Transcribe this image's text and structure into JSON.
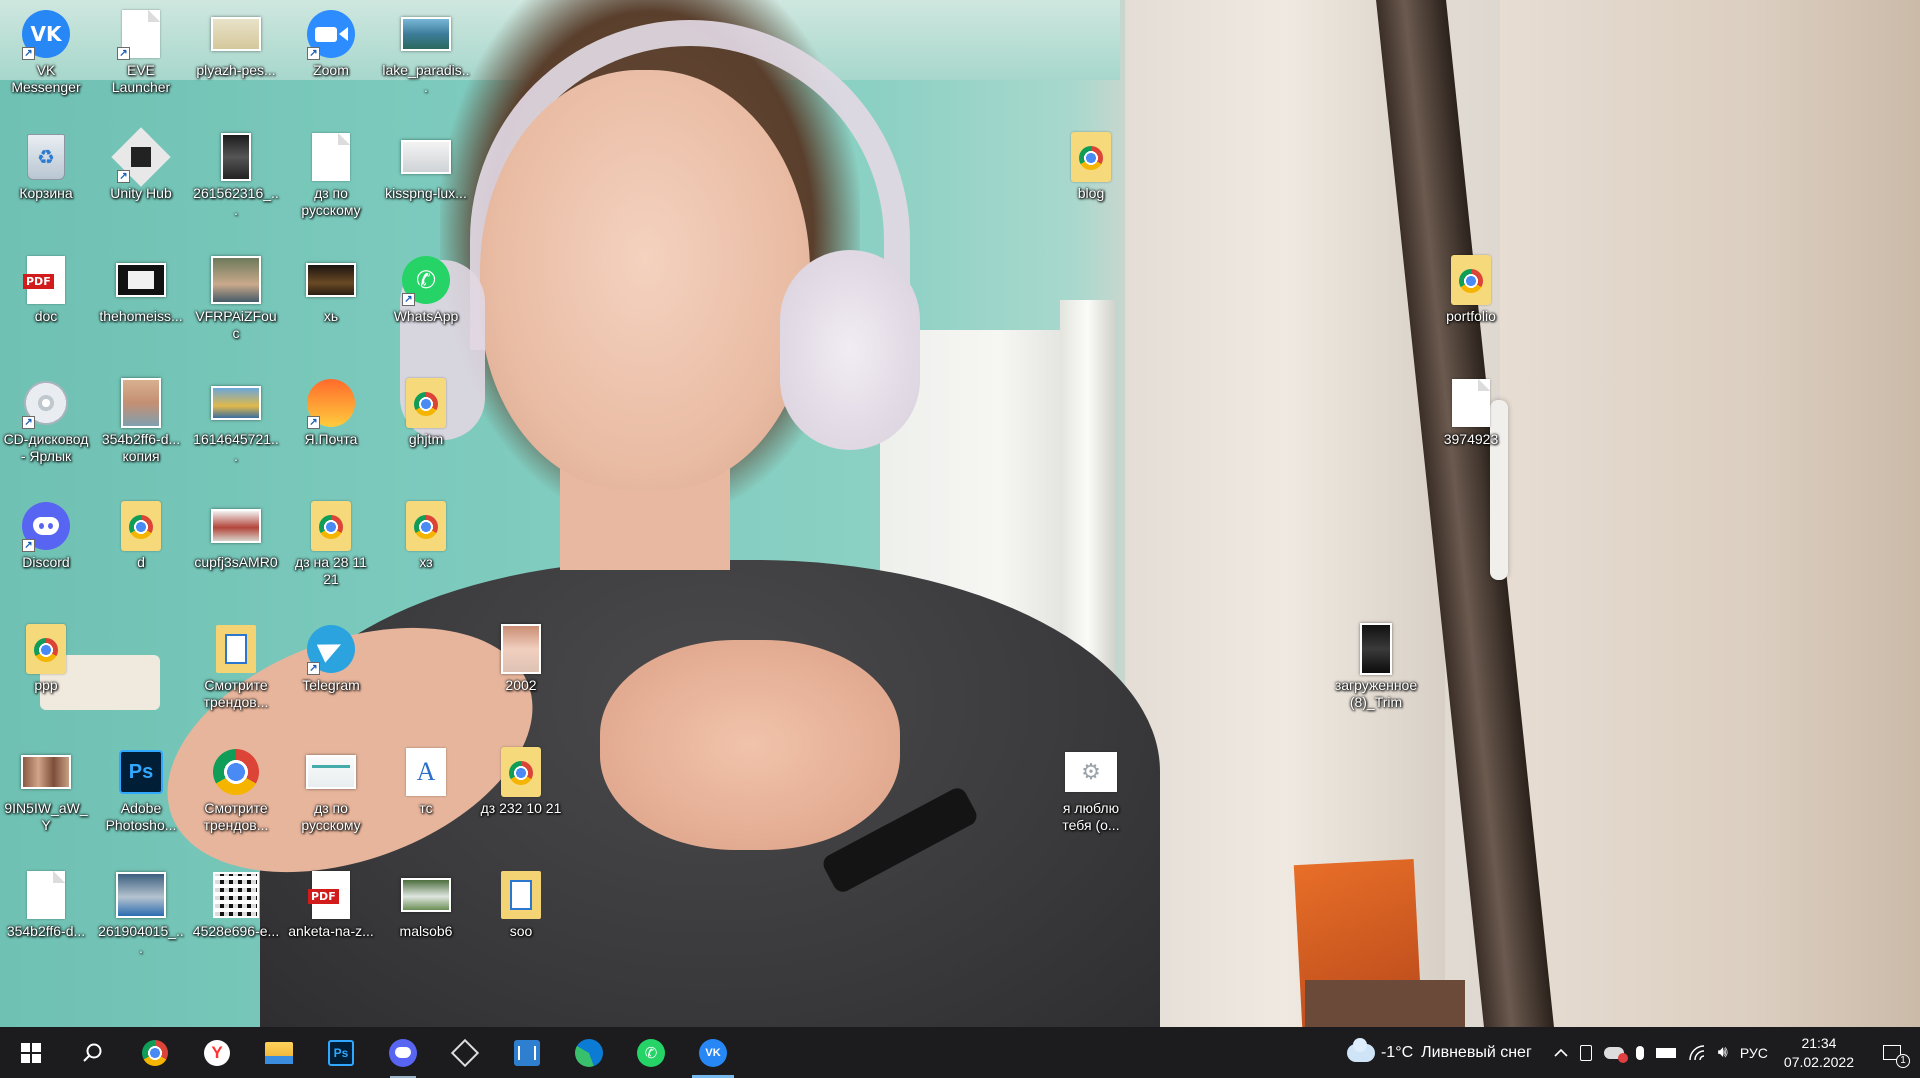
{
  "desktop": {
    "icons": [
      {
        "label": "VK Messenger",
        "icon": "vk-icon",
        "shortcut": true
      },
      {
        "label": "EVE Launcher",
        "icon": "blank-file-icon",
        "shortcut": true
      },
      {
        "label": "plyazh-pes...",
        "icon": "image-thumbnail-icon",
        "shortcut": false
      },
      {
        "label": "Zoom",
        "icon": "zoom-icon",
        "shortcut": true
      },
      {
        "label": "lake_paradis...",
        "icon": "image-thumbnail-icon",
        "shortcut": false
      },
      {
        "label": "Корзина",
        "icon": "recycle-bin-icon",
        "shortcut": false
      },
      {
        "label": "Unity Hub",
        "icon": "unity-hub-icon",
        "shortcut": true
      },
      {
        "label": "261562316_...",
        "icon": "video-thumbnail-icon",
        "shortcut": false
      },
      {
        "label": "дз по русскому",
        "icon": "blank-file-icon",
        "shortcut": false
      },
      {
        "label": "kisspng-lux...",
        "icon": "image-thumbnail-icon",
        "shortcut": false
      },
      {
        "label": "doc",
        "icon": "pdf-icon",
        "shortcut": false
      },
      {
        "label": "thehomeiss...",
        "icon": "image-thumbnail-icon",
        "shortcut": false
      },
      {
        "label": "VFRPAiZFouc",
        "icon": "image-thumbnail-icon",
        "shortcut": false
      },
      {
        "label": "хь",
        "icon": "image-thumbnail-icon",
        "shortcut": false
      },
      {
        "label": "WhatsApp",
        "icon": "whatsapp-icon",
        "shortcut": true
      },
      {
        "label": "CD-дисковод - Ярлык",
        "icon": "cd-drive-icon",
        "shortcut": true
      },
      {
        "label": "354b2ff6-d... копия",
        "icon": "image-thumbnail-icon",
        "shortcut": false
      },
      {
        "label": "1614645721...",
        "icon": "image-thumbnail-icon",
        "shortcut": false
      },
      {
        "label": "Я.Почта",
        "icon": "yandex-mail-icon",
        "shortcut": true
      },
      {
        "label": "ghjtm",
        "icon": "chrome-html-icon",
        "shortcut": false
      },
      {
        "label": "Discord",
        "icon": "discord-icon",
        "shortcut": true
      },
      {
        "label": "d",
        "icon": "chrome-html-icon",
        "shortcut": false
      },
      {
        "label": "cupfj3sAMR0",
        "icon": "image-thumbnail-icon",
        "shortcut": false
      },
      {
        "label": "дз на 28 11 21",
        "icon": "chrome-html-icon",
        "shortcut": false
      },
      {
        "label": "хз",
        "icon": "chrome-html-icon",
        "shortcut": false
      },
      {
        "label": "ppp",
        "icon": "chrome-html-icon",
        "shortcut": false
      },
      {
        "label": "Смотрите трендов...",
        "icon": "document-icon",
        "shortcut": false
      },
      {
        "label": "Telegram",
        "icon": "telegram-icon",
        "shortcut": true
      },
      {
        "label": "2002",
        "icon": "image-thumbnail-icon",
        "shortcut": false
      },
      {
        "label": "9IN5IW_aW_Y",
        "icon": "image-thumbnail-icon",
        "shortcut": false
      },
      {
        "label": "Adobe Photosho...",
        "icon": "photoshop-icon",
        "shortcut": false
      },
      {
        "label": "Смотрите трендов...",
        "icon": "chrome-icon",
        "shortcut": false
      },
      {
        "label": "дз по русскому",
        "icon": "image-thumbnail-icon",
        "shortcut": false
      },
      {
        "label": "тс",
        "icon": "text-document-icon",
        "shortcut": false
      },
      {
        "label": "дз 232 10 21",
        "icon": "chrome-html-icon",
        "shortcut": false
      },
      {
        "label": "354b2ff6-d...",
        "icon": "blank-file-icon",
        "shortcut": false
      },
      {
        "label": "261904015_...",
        "icon": "image-thumbnail-icon",
        "shortcut": false
      },
      {
        "label": "4528e696-e...",
        "icon": "qr-image-icon",
        "shortcut": false
      },
      {
        "label": "anketa-na-z...",
        "icon": "pdf-icon",
        "shortcut": false
      },
      {
        "label": "malsob6",
        "icon": "image-thumbnail-icon",
        "shortcut": false
      },
      {
        "label": "soo",
        "icon": "document-icon",
        "shortcut": false
      },
      {
        "label": "blog",
        "icon": "chrome-html-icon",
        "shortcut": false
      },
      {
        "label": "я люблю тебя (о...",
        "icon": "settings-file-icon",
        "shortcut": false
      },
      {
        "label": "portfolio",
        "icon": "chrome-html-icon",
        "shortcut": false
      },
      {
        "label": "3974923",
        "icon": "blank-file-icon",
        "shortcut": false
      },
      {
        "label": "загруженное (8)_Trim",
        "icon": "video-thumbnail-icon",
        "shortcut": false
      }
    ]
  },
  "taskbar": {
    "start_icon": "windows-start-icon",
    "search_icon": "search-icon",
    "pinned": [
      {
        "icon": "chrome-icon",
        "state": "normal"
      },
      {
        "icon": "yandex-browser-icon",
        "state": "normal"
      },
      {
        "icon": "file-explorer-icon",
        "state": "normal"
      },
      {
        "icon": "photoshop-icon",
        "state": "normal"
      },
      {
        "icon": "discord-icon",
        "state": "running"
      },
      {
        "icon": "unity-hub-icon",
        "state": "normal"
      },
      {
        "icon": "app-window-icon",
        "state": "normal"
      },
      {
        "icon": "edge-icon",
        "state": "normal"
      },
      {
        "icon": "whatsapp-icon",
        "state": "normal"
      },
      {
        "icon": "vk-icon",
        "state": "active"
      }
    ],
    "weather": {
      "icon": "snow-cloud-icon",
      "temperature": "-1°C",
      "description": "Ливневый снег"
    },
    "tray_icons": [
      "chevron-up-icon",
      "meet-now-icon",
      "onedrive-icon",
      "microphone-icon",
      "battery-icon",
      "wifi-icon",
      "volume-icon"
    ],
    "language": "РУС",
    "time": "21:34",
    "date": "07.02.2022",
    "notification_count": "1"
  },
  "colors": {
    "taskbar_bg": "#1c1c1f",
    "active_indicator": "#76b9ed",
    "label_text": "#ffffff"
  }
}
